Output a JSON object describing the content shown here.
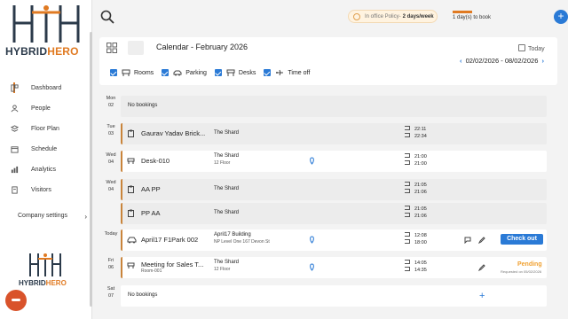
{
  "brand": {
    "logo_hybrid": "HYBRID",
    "logo_hero": "HERO"
  },
  "sidebar": {
    "items": [
      {
        "label": "Dashboard",
        "icon": "dashboard-icon",
        "active": true
      },
      {
        "label": "People",
        "icon": "people-icon"
      },
      {
        "label": "Floor Plan",
        "icon": "floor-plan-icon"
      },
      {
        "label": "Schedule",
        "icon": "schedule-icon"
      },
      {
        "label": "Analytics",
        "icon": "analytics-icon"
      },
      {
        "label": "Visitors",
        "icon": "visitors-icon"
      }
    ],
    "company_settings": "Company settings"
  },
  "topbar": {
    "policy_prefix": "In office Policy-",
    "policy_value": "2 days/week",
    "to_book": "1 day(s) to book",
    "to_book_fraction": 1.0
  },
  "calendar": {
    "title": "Calendar - February 2026",
    "today_label": "Today",
    "range_start": "02/02/2026",
    "range_sep": "-",
    "range_end": "08/02/2026",
    "filters": [
      {
        "label": "Rooms",
        "icon": "rooms-icon",
        "checked": true
      },
      {
        "label": "Parking",
        "icon": "car-icon",
        "checked": true
      },
      {
        "label": "Desks",
        "icon": "desk-icon",
        "checked": true
      },
      {
        "label": "Time off",
        "icon": "plane-icon",
        "checked": true
      }
    ]
  },
  "days": [
    {
      "dow": "Mon",
      "dom": "02"
    },
    {
      "dow": "Tue",
      "dom": "03"
    },
    {
      "dow": "Wed",
      "dom": "04"
    },
    {
      "dow": "Wed",
      "dom": "04"
    },
    {
      "dow": "Today",
      "dom": ""
    },
    {
      "dow": "Fri",
      "dom": "06"
    },
    {
      "dow": "Sat",
      "dom": "07"
    }
  ],
  "rows": {
    "mon": {
      "no_bookings": "No bookings"
    },
    "tue": {
      "name": "Gaurav Yadav Brick...",
      "building": "The Shard",
      "in": "22:11",
      "out": "22:34"
    },
    "wed1": {
      "name": "Desk-010",
      "building": "The Shard",
      "floor": "12 Floor",
      "in": "21:00",
      "out": "21:00"
    },
    "wed2": {
      "name": "AA PP",
      "building": "The Shard",
      "in": "21:05",
      "out": "21:06"
    },
    "wed3": {
      "name": "PP AA",
      "building": "The Shard",
      "in": "21:05",
      "out": "21:06"
    },
    "today": {
      "name": "April17 F1Park 002",
      "building": "April17 Building",
      "floor": "NP Level One 167 Devon St",
      "in": "12:08",
      "out": "18:00",
      "action": "Check out"
    },
    "fri": {
      "name": "Meeting for Sales T...",
      "room": "Room-001",
      "building": "The Shard",
      "floor": "12 Floor",
      "in": "14:05",
      "out": "14:35",
      "status": "Pending",
      "requested": "Requested on 05/02/2026"
    },
    "sat": {
      "no_bookings": "No bookings",
      "add": "+"
    }
  },
  "colors": {
    "accent": "#2a7ad6",
    "brand_orange": "#e07a22",
    "pending": "#f0a030"
  }
}
